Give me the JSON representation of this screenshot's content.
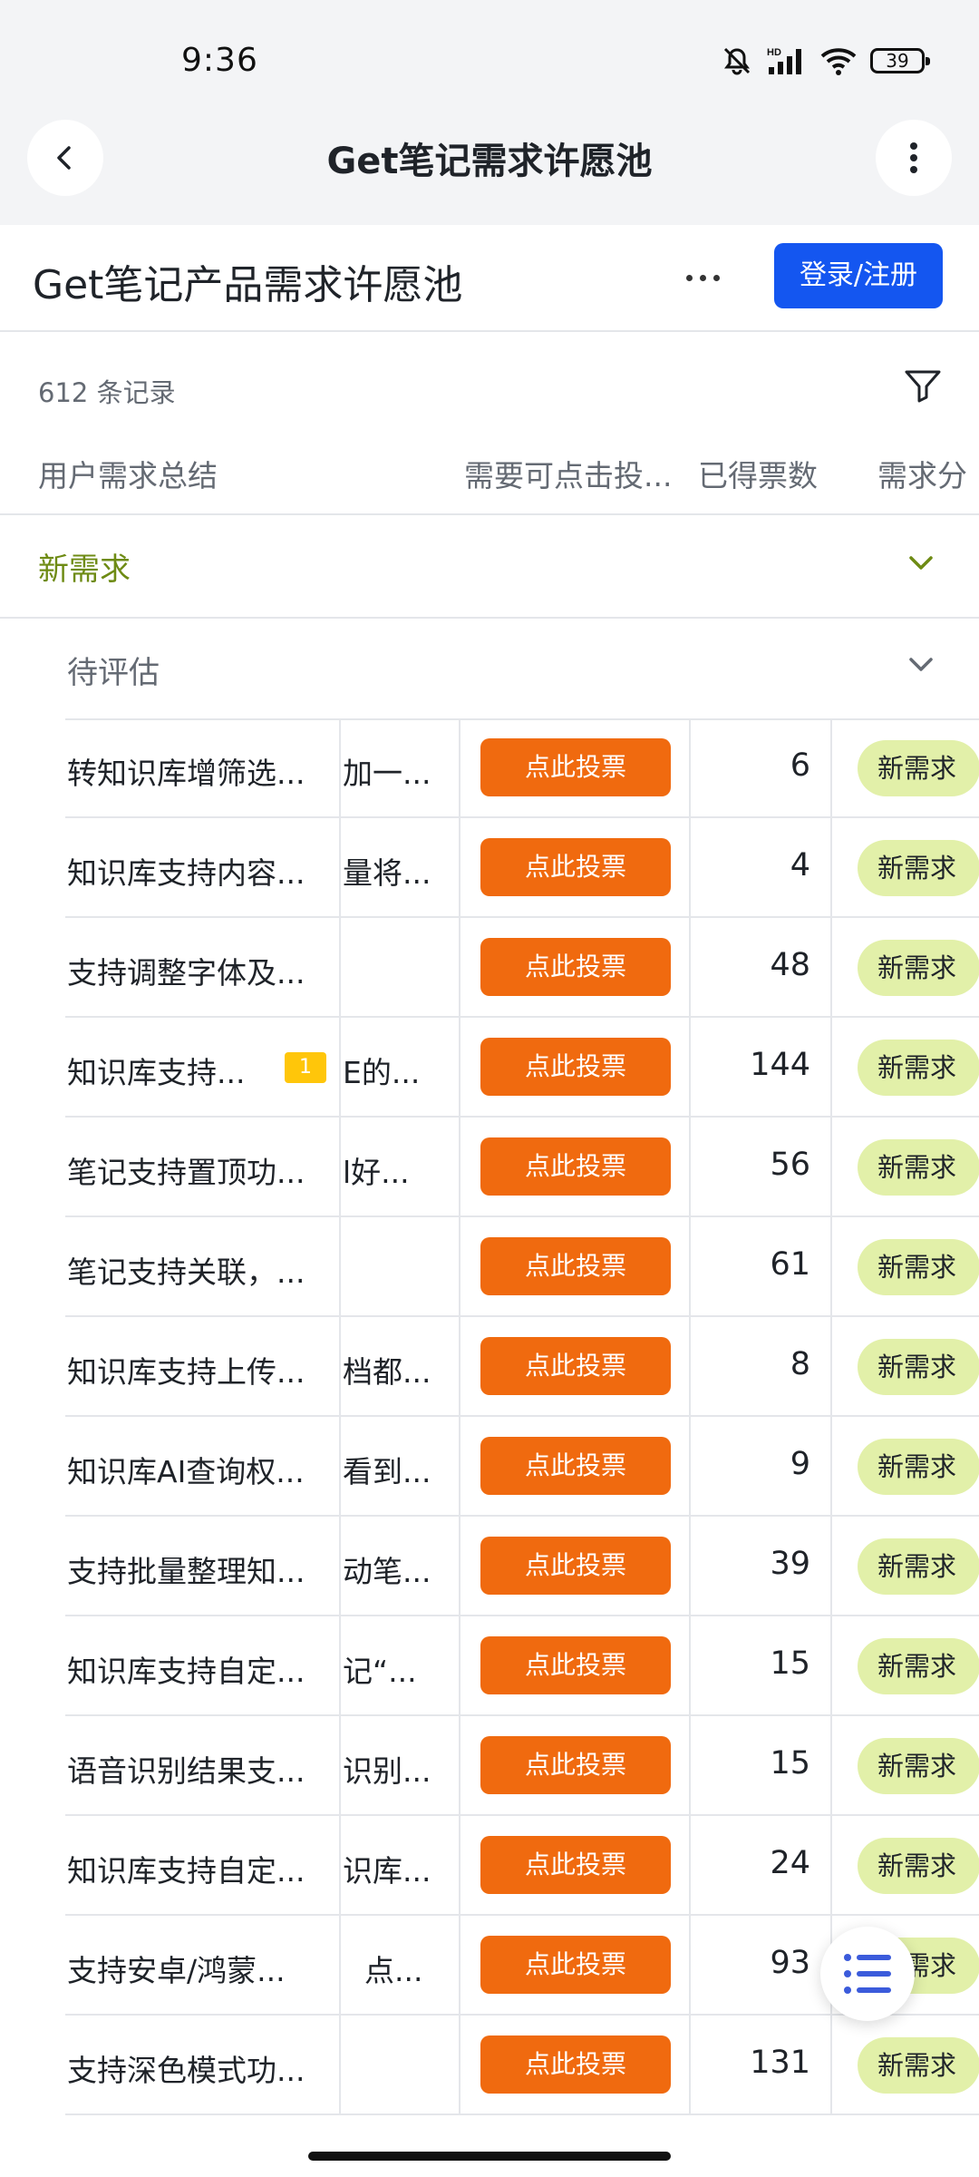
{
  "status_bar": {
    "time": "9:36",
    "battery": "39"
  },
  "app_bar": {
    "title": "Get笔记需求许愿池"
  },
  "page": {
    "title": "Get笔记产品需求许愿池",
    "login_label": "登录/注册",
    "records": "612 条记录"
  },
  "columns": [
    "用户需求总结",
    "需要可点击投...",
    "已得票数",
    "需求分"
  ],
  "groups": {
    "level1": "新需求",
    "level2": "待评估"
  },
  "vote_label": "点此投票",
  "rows": [
    {
      "summary": "转知识库增筛选...",
      "detail": "加一...",
      "votes": "6",
      "tag": "新需求"
    },
    {
      "summary": "知识库支持内容...",
      "detail": "量将...",
      "votes": "4",
      "tag": "新需求"
    },
    {
      "summary": "支持调整字体及...",
      "detail": "",
      "votes": "48",
      "tag": "新需求"
    },
    {
      "summary": "知识库支持...",
      "detail": "E的...",
      "votes": "144",
      "tag": "新需求",
      "badge": "1"
    },
    {
      "summary": "笔记支持置顶功...",
      "detail": "l好...",
      "votes": "56",
      "tag": "新需求"
    },
    {
      "summary": "笔记支持关联，...",
      "detail": "",
      "votes": "61",
      "tag": "新需求"
    },
    {
      "summary": "知识库支持上传...",
      "detail": "档都...",
      "votes": "8",
      "tag": "新需求"
    },
    {
      "summary": "知识库AI查询权...",
      "detail": "看到...",
      "votes": "9",
      "tag": "新需求"
    },
    {
      "summary": "支持批量整理知...",
      "detail": "动笔...",
      "votes": "39",
      "tag": "新需求"
    },
    {
      "summary": "知识库支持自定...",
      "detail": "记“...",
      "votes": "15",
      "tag": "新需求"
    },
    {
      "summary": "语音识别结果支...",
      "detail": "识别...",
      "votes": "15",
      "tag": "新需求"
    },
    {
      "summary": "知识库支持自定...",
      "detail": "识库...",
      "votes": "24",
      "tag": "新需求"
    },
    {
      "summary": "支持安卓/鸿蒙...",
      "detail": "点...",
      "votes": "93",
      "tag": "新需求"
    },
    {
      "summary": "支持深色模式功...",
      "detail": "",
      "votes": "131",
      "tag": "新需求"
    }
  ],
  "colors": {
    "accent": "#1456f0",
    "vote": "#f06a0f",
    "tag_bg": "#e2f0a9",
    "group_green": "#6e8b14",
    "badge": "#ffc60a"
  }
}
